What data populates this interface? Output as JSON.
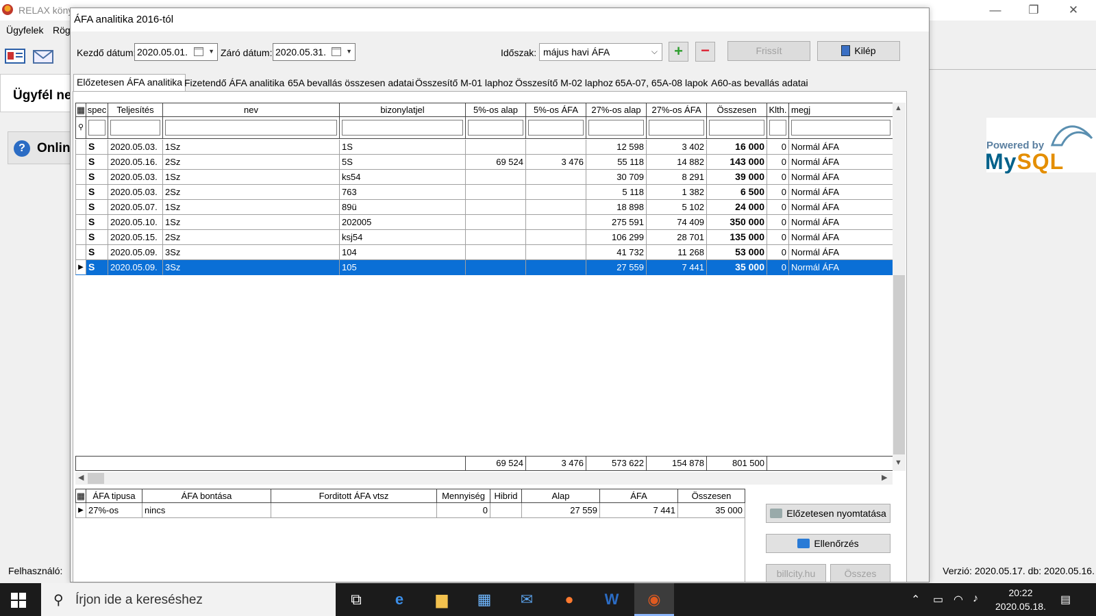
{
  "background_app": {
    "title": "RELAX köny",
    "menu": [
      "Ügyfelek",
      "Rög"
    ],
    "ugyfel_label": "Ügyfél ne",
    "online_label": "Onlin",
    "mysql_powered": "Powered by",
    "mysql_my": "My",
    "mysql_sql": "SQL",
    "status_left": "Felhasználó: ",
    "status_right": "Verzió: 2020.05.17. db: 2020.05.16."
  },
  "dialog": {
    "title": "ÁFA analitika 2016-tól",
    "start_label": "Kezdő dátum:",
    "start_value": "2020.05.01.",
    "end_label": "Záró dátum:",
    "end_value": "2020.05.31.",
    "period_label": "Időszak:",
    "period_value": "május havi ÁFA",
    "refresh_label": "Frissít",
    "exit_label": "Kilép"
  },
  "tabs": [
    "Előzetesen ÁFA analitika",
    "Fizetendő ÁFA analitika",
    "65A bevallás összesen adatai",
    "Összesítő M-01 laphoz",
    "Összesítő M-02 laphoz",
    "65A-07, 65A-08 lapok",
    "A60-as bevallás adatai"
  ],
  "main_grid": {
    "columns": [
      "spec",
      "Teljesítés",
      "nev",
      "bizonylatjel",
      "5%-os alap",
      "5%-os ÁFA",
      "27%-os alap",
      "27%-os ÁFA",
      "Összesen",
      "Klth.",
      "megj"
    ],
    "rows": [
      {
        "spec": "S",
        "date": "2020.05.03.",
        "nev": "1Sz",
        "biz": "1S",
        "alap5": "",
        "afa5": "",
        "alap27": "12 598",
        "afa27": "3 402",
        "ossz": "16 000",
        "klth": "0",
        "megj": "Normál ÁFA"
      },
      {
        "spec": "S",
        "date": "2020.05.16.",
        "nev": "2Sz",
        "biz": "5S",
        "alap5": "69 524",
        "afa5": "3 476",
        "alap27": "55 118",
        "afa27": "14 882",
        "ossz": "143 000",
        "klth": "0",
        "megj": "Normál ÁFA"
      },
      {
        "spec": "S",
        "date": "2020.05.03.",
        "nev": "1Sz",
        "biz": "ks54",
        "alap5": "",
        "afa5": "",
        "alap27": "30 709",
        "afa27": "8 291",
        "ossz": "39 000",
        "klth": "0",
        "megj": "Normál ÁFA"
      },
      {
        "spec": "S",
        "date": "2020.05.03.",
        "nev": "2Sz",
        "biz": "763",
        "alap5": "",
        "afa5": "",
        "alap27": "5 118",
        "afa27": "1 382",
        "ossz": "6 500",
        "klth": "0",
        "megj": "Normál ÁFA"
      },
      {
        "spec": "S",
        "date": "2020.05.07.",
        "nev": "1Sz",
        "biz": "89ü",
        "alap5": "",
        "afa5": "",
        "alap27": "18 898",
        "afa27": "5 102",
        "ossz": "24 000",
        "klth": "0",
        "megj": "Normál ÁFA"
      },
      {
        "spec": "S",
        "date": "2020.05.10.",
        "nev": "1Sz",
        "biz": "202005",
        "alap5": "",
        "afa5": "",
        "alap27": "275 591",
        "afa27": "74 409",
        "ossz": "350 000",
        "klth": "0",
        "megj": "Normál ÁFA"
      },
      {
        "spec": "S",
        "date": "2020.05.15.",
        "nev": "2Sz",
        "biz": "ksj54",
        "alap5": "",
        "afa5": "",
        "alap27": "106 299",
        "afa27": "28 701",
        "ossz": "135 000",
        "klth": "0",
        "megj": "Normál ÁFA"
      },
      {
        "spec": "S",
        "date": "2020.05.09.",
        "nev": "3Sz",
        "biz": "104",
        "alap5": "",
        "afa5": "",
        "alap27": "41 732",
        "afa27": "11 268",
        "ossz": "53 000",
        "klth": "0",
        "megj": "Normál ÁFA"
      },
      {
        "spec": "S",
        "date": "2020.05.09.",
        "nev": "3Sz",
        "biz": "105",
        "alap5": "",
        "afa5": "",
        "alap27": "27 559",
        "afa27": "7 441",
        "ossz": "35 000",
        "klth": "0",
        "megj": "Normál ÁFA"
      }
    ],
    "selected_row": 8,
    "totals": {
      "alap5": "69 524",
      "afa5": "3 476",
      "alap27": "573 622",
      "afa27": "154 878",
      "ossz": "801 500"
    }
  },
  "bottom_grid": {
    "columns": [
      "ÁFA tipusa",
      "ÁFA bontása",
      "Forditott ÁFA vtsz",
      "Mennyiség",
      "Hibrid",
      "Alap",
      "ÁFA",
      "Összesen"
    ],
    "row": {
      "tipus": "27%-os",
      "bontas": "nincs",
      "forditott": "",
      "menny": "0",
      "hibrid": "",
      "alap": "27 559",
      "afa": "7 441",
      "ossz": "35 000"
    }
  },
  "side_buttons": {
    "print": "Előzetesen nyomtatása",
    "check": "Ellenőrzés",
    "billcity": "billcity.hu",
    "all": "Összes"
  },
  "taskbar": {
    "search_placeholder": "Írjon ide a kereséshez",
    "time": "20:22",
    "date": "2020.05.18."
  },
  "colors": {
    "selection": "#0a6fd6",
    "taskbar": "#1b1b1b",
    "mysql_blue": "#00618a",
    "mysql_orange": "#e48e00"
  }
}
